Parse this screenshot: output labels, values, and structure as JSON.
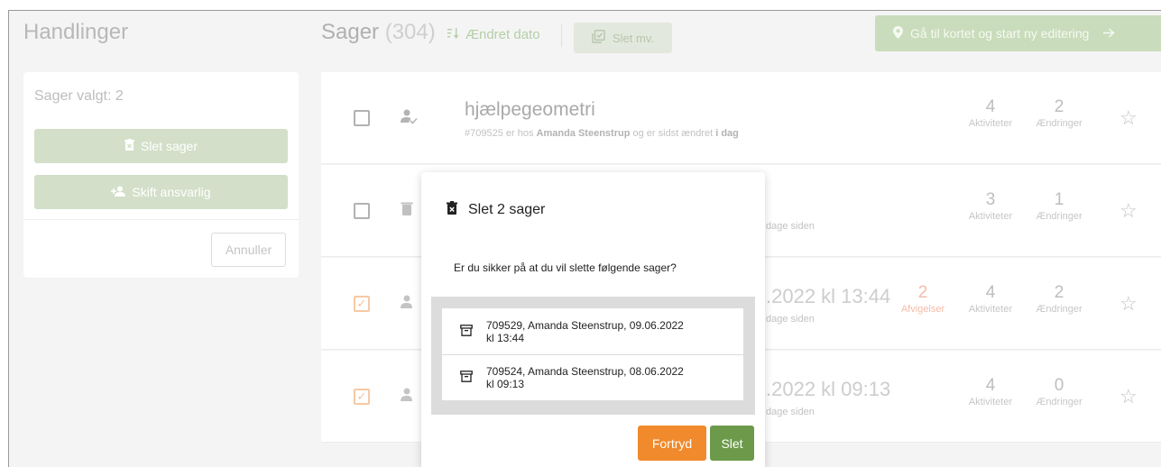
{
  "left": {
    "title": "Handlinger",
    "selected_text": "Sager valgt: 2",
    "delete_cases_label": "Slet sager",
    "change_owner_label": "Skift ansvarlig",
    "cancel_label": "Annuller"
  },
  "header": {
    "cases_title": "Sager",
    "cases_count": "(304)",
    "sort_label": "Ændret dato",
    "bulk_label": "Slet mv.",
    "map_button_label": "Gå til kortet og start ny editering"
  },
  "cases": [
    {
      "title": "hjælpegeometri",
      "sub_prefix": "#709525 er hos ",
      "owner": "Amanda Steenstrup",
      "sub_mid": " og er sidst ændret ",
      "changed": "i dag",
      "activities": "4",
      "changes": "2",
      "checked": false
    },
    {
      "sub_visible": "dage siden",
      "activities": "3",
      "changes": "1",
      "checked": false
    },
    {
      "title_visible": ".2022 kl 13:44",
      "sub_visible": "dage siden",
      "errors": "2",
      "activities": "4",
      "changes": "2",
      "checked": true
    },
    {
      "title_visible": ".2022 kl 09:13",
      "sub_visible": "dage siden",
      "activities": "4",
      "changes": "0",
      "checked": true
    }
  ],
  "labels": {
    "activities": "Aktiviteter",
    "changes": "Ændringer",
    "errors": "Afvigelser"
  },
  "modal": {
    "title": "Slet 2 sager",
    "question": "Er du sikker på at du vil slette følgende sager?",
    "items": [
      {
        "line1": "709529, Amanda Steenstrup, 09.06.2022",
        "line2": "kl 13:44"
      },
      {
        "line1": "709524, Amanda Steenstrup, 08.06.2022",
        "line2": "kl 09:13"
      }
    ],
    "cancel_label": "Fortryd",
    "confirm_label": "Slet"
  },
  "colors": {
    "accent_green": "#6c9a4a",
    "accent_orange": "#f08a2c",
    "error_text": "#f5bca8"
  }
}
